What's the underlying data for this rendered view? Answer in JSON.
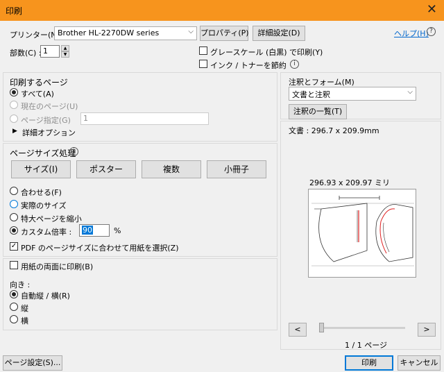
{
  "window": {
    "title": "印刷",
    "close_glyph": "✕"
  },
  "printer": {
    "label": "プリンター(N) :",
    "selected": "Brother HL-2270DW series",
    "properties_button": "プロパティ(P)",
    "advanced_button": "詳細設定(D)",
    "help_link": "ヘルプ(H)",
    "copies_label": "部数(C) :",
    "copies_value": "1",
    "grayscale_label": "グレースケール (白黒) で印刷(Y)",
    "grayscale_checked": false,
    "save_ink_label": "インク / トナーを節約",
    "save_ink_checked": false
  },
  "pages_to_print": {
    "heading": "印刷するページ",
    "all_label": "すべて(A)",
    "current_label": "現在のページ(U)",
    "pages_label": "ページ指定(G)",
    "pages_value": "1",
    "more_options": "詳細オプション"
  },
  "page_sizing": {
    "heading": "ページサイズ処理",
    "tabs": [
      "サイズ(I)",
      "ポスター",
      "複数",
      "小冊子"
    ],
    "fit_label": "合わせる(F)",
    "actual_label": "実際のサイズ",
    "shrink_label": "特大ページを縮小",
    "custom_label": "カスタム倍率 :",
    "custom_value": "90",
    "percent": "%",
    "choose_paper_label": "PDF のページサイズに合わせて用紙を選択(Z)",
    "choose_paper_checked": true
  },
  "duplex": {
    "label": "用紙の両面に印刷(B)",
    "checked": false
  },
  "orientation": {
    "heading": "向き :",
    "auto_label": "自動縦 / 横(R)",
    "portrait_label": "縦",
    "landscape_label": "横"
  },
  "comments_forms": {
    "heading": "注釈とフォーム(M)",
    "selected": "文書と注釈",
    "summarize_button": "注釈の一覧(T)"
  },
  "preview": {
    "document_size": "文書 : 296.7 x 209.9mm",
    "paper_size": "296.93 x 209.97 ミリ",
    "prev_glyph": "<",
    "next_glyph": ">",
    "page_indicator": "1 / 1 ページ",
    "colors": {
      "red_line": "#e02020",
      "outline": "#333333"
    }
  },
  "footer": {
    "page_setup_button": "ページ設定(S)...",
    "print_button": "印刷",
    "cancel_button": "キャンセル"
  }
}
